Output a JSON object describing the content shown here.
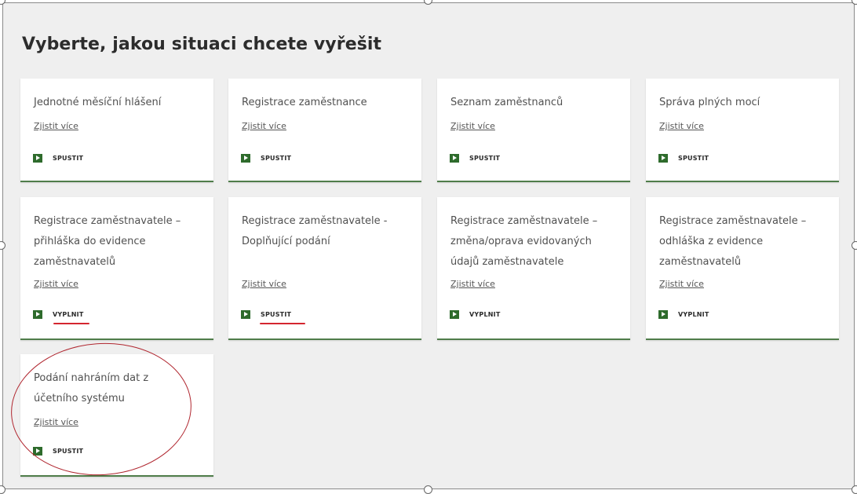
{
  "heading": "Vyberte, jakou situaci chcete vyřešit",
  "colors": {
    "accent": "#2e6b2c",
    "card_border": "#4f7d4a",
    "annotation_red": "#d4262f"
  },
  "cards": [
    {
      "title": "Jednotné měsíční hlášení",
      "link": "Zjistit více",
      "action": "SPUSTIT",
      "icon": "arrow-right-icon"
    },
    {
      "title": "Registrace zaměstnance",
      "link": "Zjistit více",
      "action": "SPUSTIT",
      "icon": "arrow-right-icon"
    },
    {
      "title": "Seznam zaměstnanců",
      "link": "Zjistit více",
      "action": "SPUSTIT",
      "icon": "arrow-right-icon"
    },
    {
      "title": "Správa plných mocí",
      "link": "Zjistit více",
      "action": "SPUSTIT",
      "icon": "arrow-right-icon"
    },
    {
      "title": "Registrace zaměstnavatele – přihláška do evidence zaměstnavatelů",
      "link": "Zjistit více",
      "action": "VYPLNIT",
      "icon": "arrow-right-icon"
    },
    {
      "title": "Registrace zaměstnavatele - Doplňující podání",
      "link": "Zjistit více",
      "action": "SPUSTIT",
      "icon": "arrow-right-icon"
    },
    {
      "title": "Registrace zaměstnavatele – změna/oprava evidovaných údajů zaměstnavatele",
      "link": "Zjistit více",
      "action": "VYPLNIT",
      "icon": "arrow-right-icon"
    },
    {
      "title": "Registrace zaměstnavatele – odhláška z evidence zaměstnavatelů",
      "link": "Zjistit více",
      "action": "VYPLNIT",
      "icon": "arrow-right-icon"
    },
    {
      "title": "Podání nahráním dat z účetního systému",
      "link": "Zjistit více",
      "action": "SPUSTIT",
      "icon": "arrow-right-icon"
    }
  ]
}
